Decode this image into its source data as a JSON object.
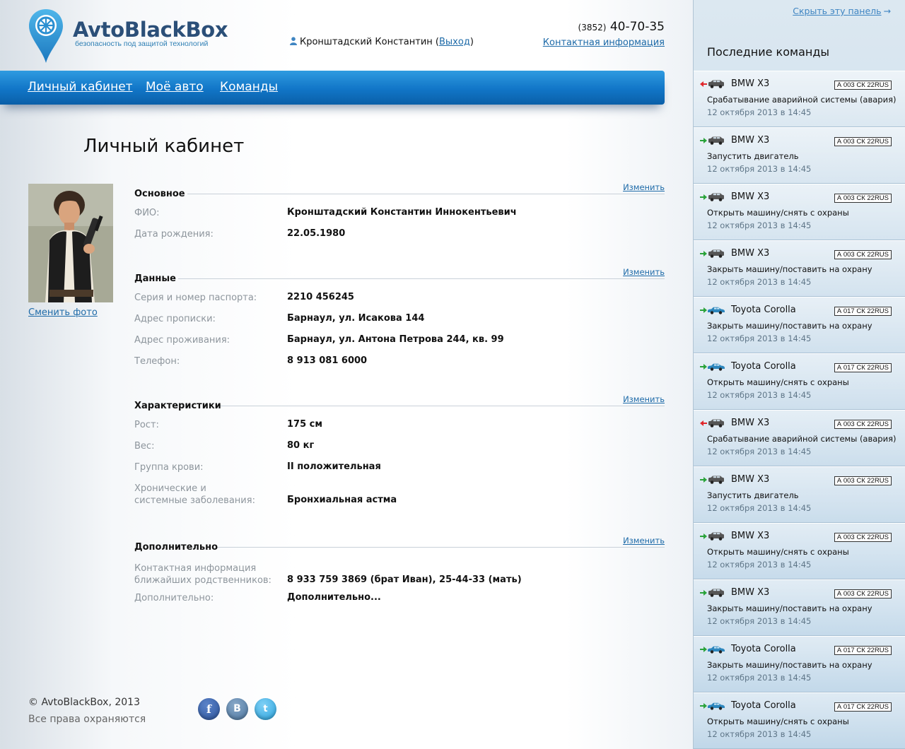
{
  "header": {
    "brand": "AvtoBlackBox",
    "tagline": "безопасность под защитой технологий",
    "user_name": "Кронштадский Константин",
    "logout": "Выход",
    "phone_code": "(3852)",
    "phone_number": "40-70-35",
    "contacts_link": "Контактная информация"
  },
  "nav": {
    "items": [
      "Личный кабинет",
      "Моё авто",
      "Команды"
    ]
  },
  "page": {
    "title": "Личный кабинет",
    "change_photo": "Сменить фото",
    "edit_label": "Изменить"
  },
  "sections": [
    {
      "title": "Основное",
      "rows": [
        {
          "label": "ФИО:",
          "value": "Кронштадский Константин Иннокентьевич"
        },
        {
          "label": "Дата рождения:",
          "value": "22.05.1980"
        }
      ]
    },
    {
      "title": "Данные",
      "rows": [
        {
          "label": "Серия и номер паспорта:",
          "value": "2210 456245"
        },
        {
          "label": "Адрес прописки:",
          "value": "Барнаул, ул. Исакова 144"
        },
        {
          "label": "Адрес проживания:",
          "value": "Барнаул, ул. Антона Петрова 244, кв. 99"
        },
        {
          "label": "Телефон:",
          "value": "8 913 081 6000"
        }
      ]
    },
    {
      "title": "Характеристики",
      "rows": [
        {
          "label": "Рост:",
          "value": "175 см"
        },
        {
          "label": "Вес:",
          "value": "80 кг"
        },
        {
          "label": "Группа крови:",
          "value": "II положительная"
        },
        {
          "label_line1": "Хронические и",
          "label_line2": "системные заболевания:",
          "value": "Бронхиальная астма"
        }
      ]
    },
    {
      "title": "Дополнительно",
      "rows": [
        {
          "label_line1": "Контактная информация",
          "label_line2": "ближайших родственников:",
          "value": "8 933 759 3869 (брат Иван), 25-44-33 (мать)"
        },
        {
          "label": "Дополнительно:",
          "value": "Дополнительно..."
        }
      ]
    }
  ],
  "footer": {
    "copyright": "© AvtoBlackBox, 2013",
    "rights": "Все права охраняются",
    "social": [
      "f",
      "B",
      "t"
    ]
  },
  "sidebar": {
    "hide_panel": "Скрыть эту панель",
    "hide_arrow": "→",
    "title": "Последние команды",
    "colors": {
      "alarm": "#e0262b",
      "ok": "#2aa33a"
    },
    "commands": [
      {
        "car": "BMW X3",
        "car_icon": "suv-icon",
        "plate": "А 003 СК 22RUS",
        "direction": "incoming",
        "text": "Срабатывание аварийной системы (авария)",
        "time": "12 октября 2013 в 14:45"
      },
      {
        "car": "BMW X3",
        "car_icon": "suv-icon",
        "plate": "А 003 СК 22RUS",
        "direction": "outgoing",
        "text": "Запустить двигатель",
        "time": "12 октября 2013 в 14:45"
      },
      {
        "car": "BMW X3",
        "car_icon": "suv-icon",
        "plate": "А 003 СК 22RUS",
        "direction": "outgoing",
        "text": "Открыть машину/снять с охраны",
        "time": "12 октября 2013 в 14:45"
      },
      {
        "car": "BMW X3",
        "car_icon": "suv-icon",
        "plate": "А 003 СК 22RUS",
        "direction": "outgoing",
        "text": "Закрыть машину/поставить на охрану",
        "time": "12 октября 2013 в 14:45"
      },
      {
        "car": "Toyota Corolla",
        "car_icon": "sedan-icon",
        "plate": "А 017 СК 22RUS",
        "direction": "outgoing",
        "text": "Закрыть машину/поставить на охрану",
        "time": "12 октября 2013 в 14:45"
      },
      {
        "car": "Toyota Corolla",
        "car_icon": "sedan-icon",
        "plate": "А 017 СК 22RUS",
        "direction": "outgoing",
        "text": "Открыть машину/снять с охраны",
        "time": "12 октября 2013 в 14:45"
      },
      {
        "car": "BMW X3",
        "car_icon": "suv-icon",
        "plate": "А 003 СК 22RUS",
        "direction": "incoming",
        "text": "Срабатывание аварийной системы (авария)",
        "time": "12 октября 2013 в 14:45"
      },
      {
        "car": "BMW X3",
        "car_icon": "suv-icon",
        "plate": "А 003 СК 22RUS",
        "direction": "outgoing",
        "text": "Запустить двигатель",
        "time": "12 октября 2013 в 14:45"
      },
      {
        "car": "BMW X3",
        "car_icon": "suv-icon",
        "plate": "А 003 СК 22RUS",
        "direction": "outgoing",
        "text": "Открыть машину/снять с охраны",
        "time": "12 октября 2013 в 14:45"
      },
      {
        "car": "BMW X3",
        "car_icon": "suv-icon",
        "plate": "А 003 СК 22RUS",
        "direction": "outgoing",
        "text": "Закрыть машину/поставить на охрану",
        "time": "12 октября 2013 в 14:45"
      },
      {
        "car": "Toyota Corolla",
        "car_icon": "sedan-icon",
        "plate": "А 017 СК 22RUS",
        "direction": "outgoing",
        "text": "Закрыть машину/поставить на охрану",
        "time": "12 октября 2013 в 14:45"
      },
      {
        "car": "Toyota Corolla",
        "car_icon": "sedan-icon",
        "plate": "А 017 СК 22RUS",
        "direction": "outgoing",
        "text": "Открыть машину/снять с охраны",
        "time": "12 октября 2013 в 14:45"
      }
    ]
  }
}
